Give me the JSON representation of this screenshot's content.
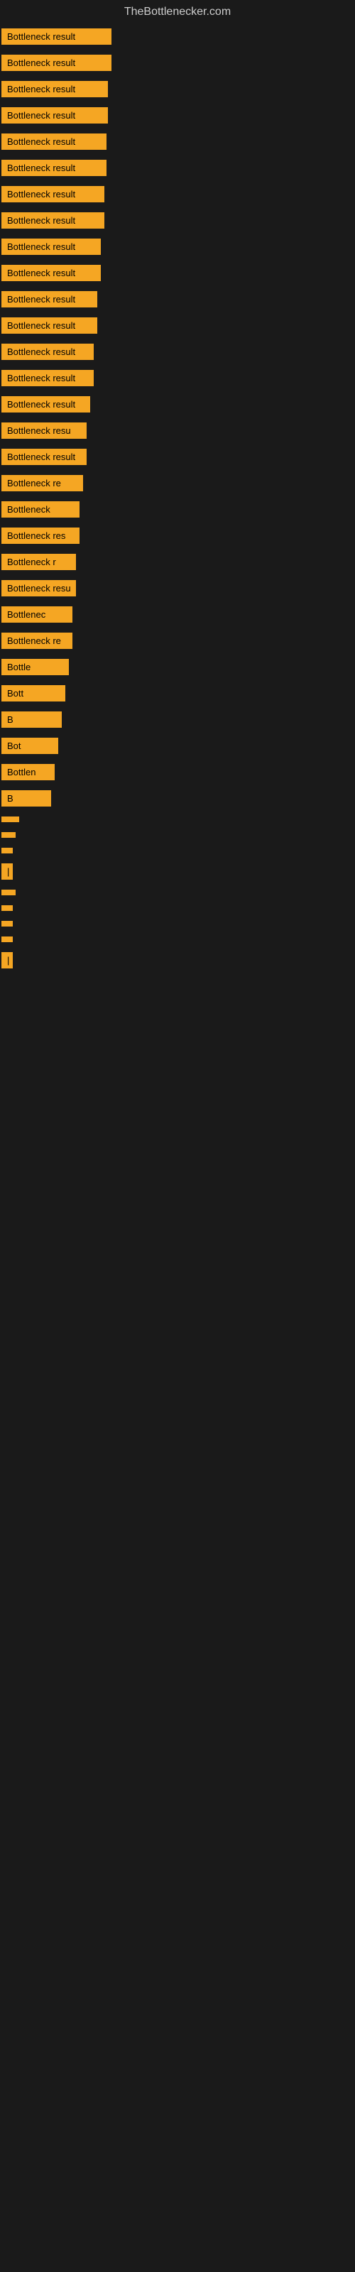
{
  "site": {
    "title": "TheBottlenecker.com"
  },
  "bars": [
    {
      "label": "Bottleneck result",
      "widthClass": "bar-w1"
    },
    {
      "label": "Bottleneck result",
      "widthClass": "bar-w1"
    },
    {
      "label": "Bottleneck result",
      "widthClass": "bar-w2"
    },
    {
      "label": "Bottleneck result",
      "widthClass": "bar-w2"
    },
    {
      "label": "Bottleneck result",
      "widthClass": "bar-w3"
    },
    {
      "label": "Bottleneck result",
      "widthClass": "bar-w3"
    },
    {
      "label": "Bottleneck result",
      "widthClass": "bar-w4"
    },
    {
      "label": "Bottleneck result",
      "widthClass": "bar-w4"
    },
    {
      "label": "Bottleneck result",
      "widthClass": "bar-w5"
    },
    {
      "label": "Bottleneck result",
      "widthClass": "bar-w5"
    },
    {
      "label": "Bottleneck result",
      "widthClass": "bar-w6"
    },
    {
      "label": "Bottleneck result",
      "widthClass": "bar-w6"
    },
    {
      "label": "Bottleneck result",
      "widthClass": "bar-w7"
    },
    {
      "label": "Bottleneck result",
      "widthClass": "bar-w7"
    },
    {
      "label": "Bottleneck result",
      "widthClass": "bar-w8"
    },
    {
      "label": "Bottleneck resu",
      "widthClass": "bar-w9"
    },
    {
      "label": "Bottleneck result",
      "widthClass": "bar-w9"
    },
    {
      "label": "Bottleneck re",
      "widthClass": "bar-w10"
    },
    {
      "label": "Bottleneck",
      "widthClass": "bar-w11"
    },
    {
      "label": "Bottleneck res",
      "widthClass": "bar-w11"
    },
    {
      "label": "Bottleneck r",
      "widthClass": "bar-w12"
    },
    {
      "label": "Bottleneck resu",
      "widthClass": "bar-w12"
    },
    {
      "label": "Bottlenec",
      "widthClass": "bar-w13"
    },
    {
      "label": "Bottleneck re",
      "widthClass": "bar-w13"
    },
    {
      "label": "Bottle",
      "widthClass": "bar-w14"
    },
    {
      "label": "Bott",
      "widthClass": "bar-w15"
    },
    {
      "label": "B",
      "widthClass": "bar-w16"
    },
    {
      "label": "Bot",
      "widthClass": "bar-w17"
    },
    {
      "label": "Bottlen",
      "widthClass": "bar-w18"
    },
    {
      "label": "B",
      "widthClass": "bar-w19"
    },
    {
      "label": "",
      "widthClass": "bar-w28"
    },
    {
      "label": "",
      "widthClass": "bar-w29"
    },
    {
      "label": "",
      "widthClass": "bar-w30"
    },
    {
      "label": "|",
      "widthClass": "bar-w31"
    },
    {
      "label": "",
      "widthClass": "bar-w29"
    },
    {
      "label": "",
      "widthClass": "bar-w30"
    },
    {
      "label": "",
      "widthClass": "bar-w30"
    },
    {
      "label": "",
      "widthClass": "bar-w31"
    },
    {
      "label": "|",
      "widthClass": "bar-w32"
    }
  ],
  "colors": {
    "bar_bg": "#f5a623",
    "page_bg": "#1a1a1a",
    "title_color": "#cccccc"
  }
}
